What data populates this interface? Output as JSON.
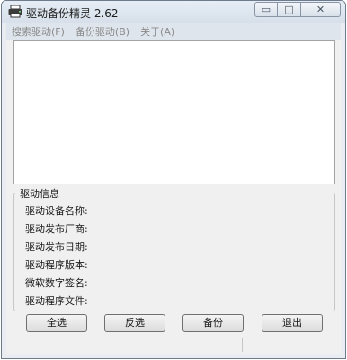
{
  "window": {
    "title": "驱动备份精灵 2.62",
    "icon": "app-printer-icon"
  },
  "caption": {
    "minimize": "▭",
    "maximize": "□",
    "close": "✕"
  },
  "menu": [
    "搜索驱动(F)",
    "备份驱动(B)",
    "关于(A)"
  ],
  "info": {
    "group_title": "驱动信息",
    "labels": [
      "驱动设备名称:",
      "驱动发布厂商:",
      "驱动发布日期:",
      "驱动程序版本:",
      "微软数字签名:",
      "驱动程序文件:"
    ]
  },
  "buttons": {
    "select_all": "全选",
    "invert": "反选",
    "backup": "备份",
    "exit": "退出"
  }
}
